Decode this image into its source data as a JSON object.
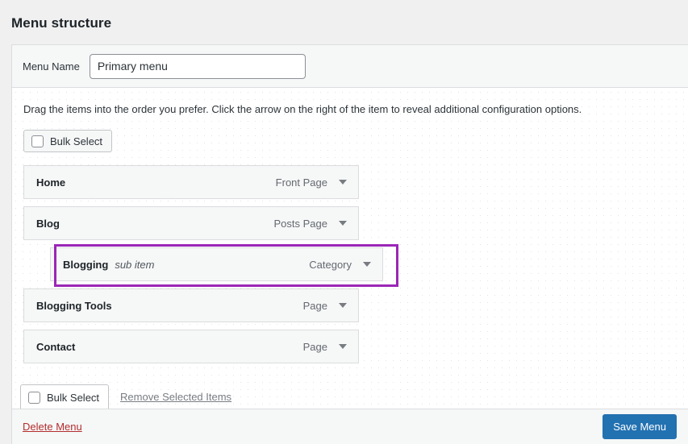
{
  "page": {
    "heading": "Menu structure"
  },
  "menu_name": {
    "label": "Menu Name",
    "value": "Primary menu",
    "placeholder": "Enter menu name here"
  },
  "instructions": "Drag the items into the order you prefer. Click the arrow on the right of the item to reveal additional configuration options.",
  "bulk_select_top": {
    "label": "Bulk Select"
  },
  "menu_items": [
    {
      "title": "Home",
      "subtitle": "",
      "type": "Front Page",
      "depth": 0,
      "highlighted": false
    },
    {
      "title": "Blog",
      "subtitle": "",
      "type": "Posts Page",
      "depth": 0,
      "highlighted": false
    },
    {
      "title": "Blogging",
      "subtitle": "sub item",
      "type": "Category",
      "depth": 1,
      "highlighted": true
    },
    {
      "title": "Blogging Tools",
      "subtitle": "",
      "type": "Page",
      "depth": 0,
      "highlighted": false
    },
    {
      "title": "Contact",
      "subtitle": "",
      "type": "Page",
      "depth": 0,
      "highlighted": false
    }
  ],
  "bottom_bar": {
    "bulk_select_label": "Bulk Select",
    "remove_selected_label": "Remove Selected Items"
  },
  "footer": {
    "delete_label": "Delete Menu",
    "save_label": "Save Menu"
  },
  "colors": {
    "highlight": "#9b26b6",
    "save_button": "#2271b1",
    "delete_link": "#b32d2e",
    "panel_header_bg": "#f6f7f7"
  }
}
